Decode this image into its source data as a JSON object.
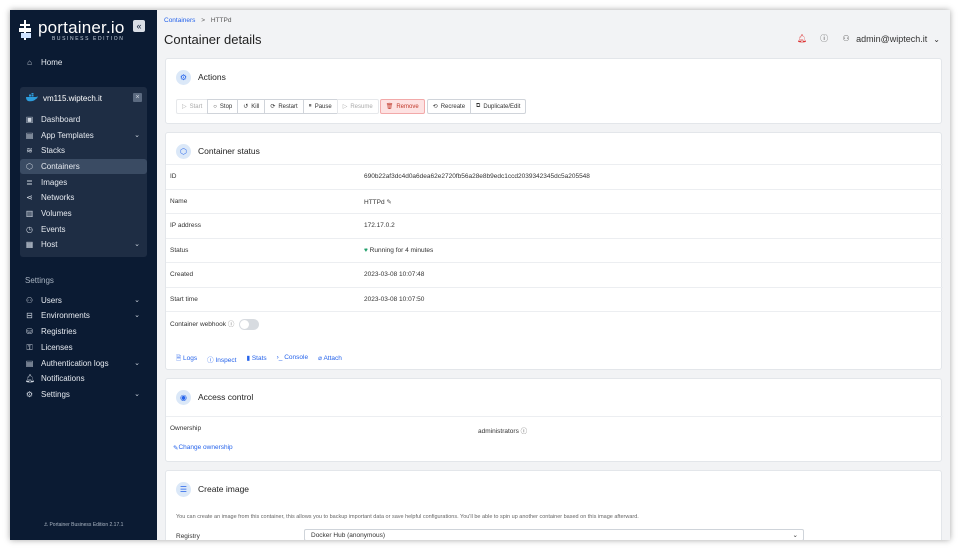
{
  "sidebar": {
    "logo": {
      "name": "portainer.io",
      "sub": "BUSINESS EDITION"
    },
    "home": "Home",
    "environment": {
      "name": "vm115.wiptech.it"
    },
    "env_items": [
      {
        "label": "Dashboard",
        "icon": "dashboard-icon"
      },
      {
        "label": "App Templates",
        "icon": "template-icon",
        "chevron": true
      },
      {
        "label": "Stacks",
        "icon": "stacks-icon"
      },
      {
        "label": "Containers",
        "icon": "container-icon",
        "active": true
      },
      {
        "label": "Images",
        "icon": "images-icon"
      },
      {
        "label": "Networks",
        "icon": "network-icon"
      },
      {
        "label": "Volumes",
        "icon": "volume-icon"
      },
      {
        "label": "Events",
        "icon": "events-icon"
      },
      {
        "label": "Host",
        "icon": "host-icon",
        "chevron": true
      }
    ],
    "settings_heading": "Settings",
    "settings_items": [
      {
        "label": "Users",
        "chevron": true
      },
      {
        "label": "Environments",
        "chevron": true
      },
      {
        "label": "Registries"
      },
      {
        "label": "Licenses"
      },
      {
        "label": "Authentication logs",
        "chevron": true
      },
      {
        "label": "Notifications"
      },
      {
        "label": "Settings",
        "chevron": true
      }
    ],
    "footer": "Portainer Business Edition 2.17.1"
  },
  "header": {
    "breadcrumb_root": "Containers",
    "breadcrumb_sep": ">",
    "breadcrumb_current": "HTTPd",
    "title": "Container details",
    "user": "admin@wiptech.it"
  },
  "actions": {
    "title": "Actions",
    "buttons": [
      "Start",
      "Stop",
      "Kill",
      "Restart",
      "Pause",
      "Resume",
      "Remove",
      "Recreate",
      "Duplicate/Edit"
    ]
  },
  "status": {
    "title": "Container status",
    "rows": [
      {
        "key": "ID",
        "value": "690b22af3dc4d0a6dea62e2720fb56a28e8b9edc1ccd2039342345dc5a205548"
      },
      {
        "key": "Name",
        "value": "HTTPd"
      },
      {
        "key": "IP address",
        "value": "172.17.0.2"
      },
      {
        "key": "Status",
        "value": "Running for 4 minutes"
      },
      {
        "key": "Created",
        "value": "2023-03-08 10:07:48"
      },
      {
        "key": "Start time",
        "value": "2023-03-08 10:07:50"
      }
    ],
    "webhook_label": "Container webhook",
    "links": [
      "Logs",
      "Inspect",
      "Stats",
      "Console",
      "Attach"
    ]
  },
  "access": {
    "title": "Access control",
    "ownership_label": "Ownership",
    "ownership_value": "administrators",
    "change_link": "Change ownership"
  },
  "create_image": {
    "title": "Create image",
    "description": "You can create an image from this container, this allows you to backup important data or save helpful configurations. You'll be able to spin up another container based on this image afterward.",
    "registry_label": "Registry",
    "registry_value": "Docker Hub (anonymous)"
  },
  "colors": {
    "sidebar_bg": "#0b1b33",
    "accent": "#2563eb",
    "danger_bg": "#fde2e2"
  }
}
